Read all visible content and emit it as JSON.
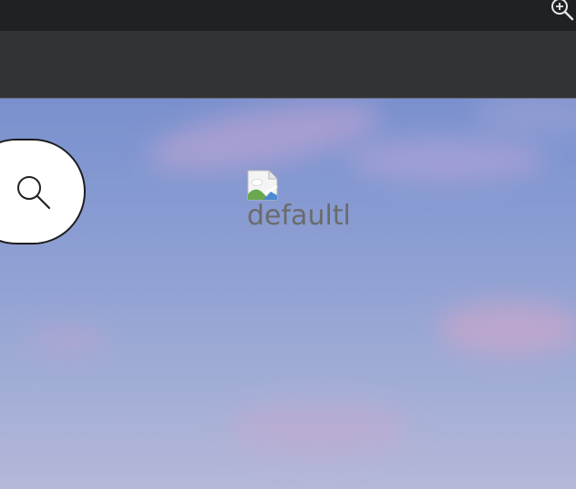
{
  "image": {
    "alt": "defaultl",
    "icon": "broken-image-icon"
  },
  "search": {
    "icon": "search-icon"
  },
  "topbar": {
    "icon": "zoom-in-icon"
  },
  "colors": {
    "topbar": "#202124",
    "toolbar": "#323336",
    "sky_top": "#6f86c9",
    "sky_bottom": "#b5b8d8"
  }
}
